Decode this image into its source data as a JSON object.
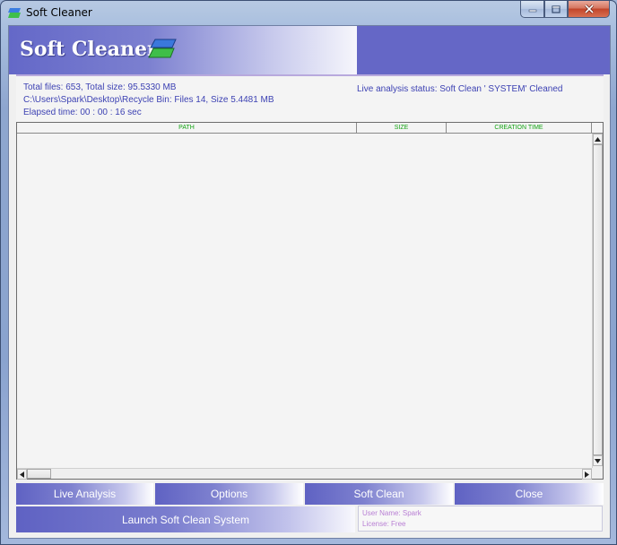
{
  "window": {
    "title": "Soft Cleaner"
  },
  "header": {
    "brand_title": "Soft Cleaner",
    "brand_icon": "soft-cleaner-logo-icon"
  },
  "info": {
    "total_line": "Total files: 653, Total size: 95.5330 MB",
    "recycle_line": "C:\\Users\\Spark\\Desktop\\Recycle Bin: Files 14, Size 5.4481 MB",
    "elapsed_line": "Elapsed time: 00 : 00 : 16 sec",
    "live_status": "Live analysis status: Soft Clean ' SYSTEM' Cleaned"
  },
  "file_list": {
    "columns": [
      "PATH",
      "SIZE",
      "CREATION TIME"
    ],
    "rows": []
  },
  "buttons": {
    "live_analysis": "Live Analysis",
    "options": "Options",
    "soft_clean": "Soft Clean",
    "close": "Close",
    "launch": "Launch Soft Clean System"
  },
  "user": {
    "name_line": "User Name: Spark",
    "license_line": "License: Free"
  },
  "colors": {
    "accent": "#6567c6",
    "info_text": "#3d42b3",
    "column_header_text": "#13a313",
    "user_text": "#b87fd4"
  }
}
